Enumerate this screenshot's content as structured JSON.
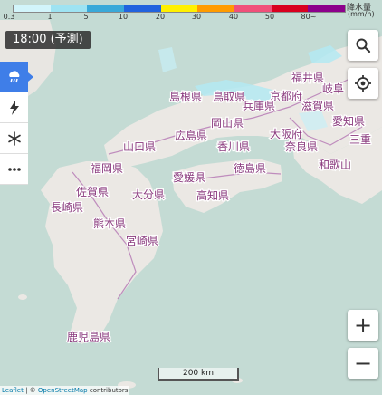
{
  "legend": {
    "colors": [
      "#d2f5fb",
      "#9ee3f2",
      "#3aa9d9",
      "#2163de",
      "#fff000",
      "#ff9b00",
      "#f0507a",
      "#d8001f",
      "#8c008c"
    ],
    "ticks": [
      "0.3",
      "1",
      "5",
      "10",
      "20",
      "30",
      "40",
      "50",
      "80~"
    ],
    "unit_title": "降水量",
    "unit": "(mm/h)"
  },
  "time_label": "18:00 (予測)",
  "layers": [
    {
      "name": "rain",
      "icon": "rain-cloud-icon",
      "active": true
    },
    {
      "name": "lightning",
      "icon": "lightning-icon",
      "active": false
    },
    {
      "name": "snow",
      "icon": "snowflake-icon",
      "active": false
    },
    {
      "name": "more",
      "icon": "more-dots-icon",
      "active": false
    }
  ],
  "controls": {
    "search_icon": "search-icon",
    "locate_icon": "locate-icon",
    "zoom_in": "+",
    "zoom_out": "−"
  },
  "scale_label": "200 km",
  "attribution": {
    "leaflet": "Leaflet",
    "sep": " | © ",
    "osm": "OpenStreetMap",
    "contrib": " contributors"
  },
  "prefectures": {
    "shimane": "島根県",
    "tottori": "鳥取県",
    "kyoto": "京都府",
    "fukui": "福井県",
    "shiga": "滋賀県",
    "gifu": "岐阜",
    "hyogo": "兵庫県",
    "okayama": "岡山県",
    "hiroshima": "広島県",
    "yamaguchi": "山口県",
    "kagawa": "香川県",
    "osaka": "大阪府",
    "nara": "奈良県",
    "aichi": "愛知県",
    "mie": "三重",
    "wakayama": "和歌山",
    "fukuoka": "福岡県",
    "saga": "佐賀県",
    "nagasaki": "長崎県",
    "oita": "大分県",
    "ehime": "愛媛県",
    "tokushima": "徳島県",
    "kochi": "高知県",
    "kumamoto": "熊本県",
    "miyazaki": "宮崎県",
    "kagoshima": "鹿児島県"
  }
}
